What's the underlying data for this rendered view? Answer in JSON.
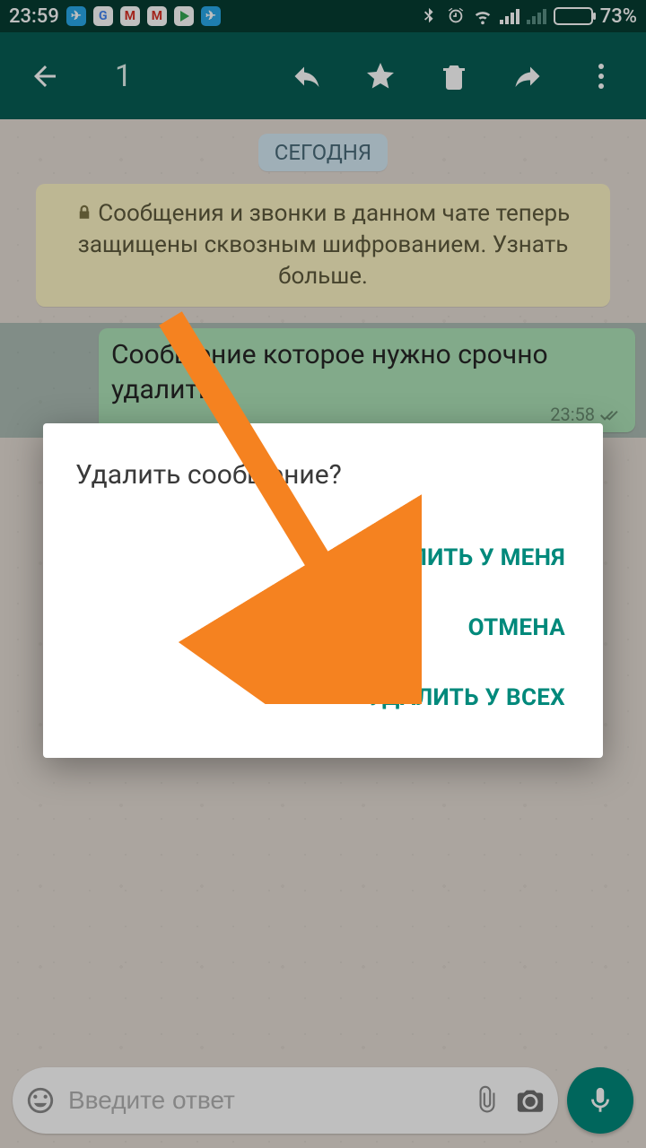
{
  "statusbar": {
    "time": "23:59",
    "battery_pct": "73%"
  },
  "appbar": {
    "selected_count": "1"
  },
  "chat": {
    "date_label": "СЕГОДНЯ",
    "encryption_notice": "Сообщения и звонки в данном чате теперь защищены сквозным шифрованием. Узнать больше.",
    "message_text": "Сообщение которое нужно срочно удалить",
    "message_time": "23:58"
  },
  "input": {
    "placeholder": "Введите ответ"
  },
  "dialog": {
    "title": "Удалить сообщение?",
    "delete_for_me": "УДАЛИТЬ У МЕНЯ",
    "cancel": "ОТМЕНА",
    "delete_for_all": "УДАЛИТЬ У ВСЕХ"
  }
}
